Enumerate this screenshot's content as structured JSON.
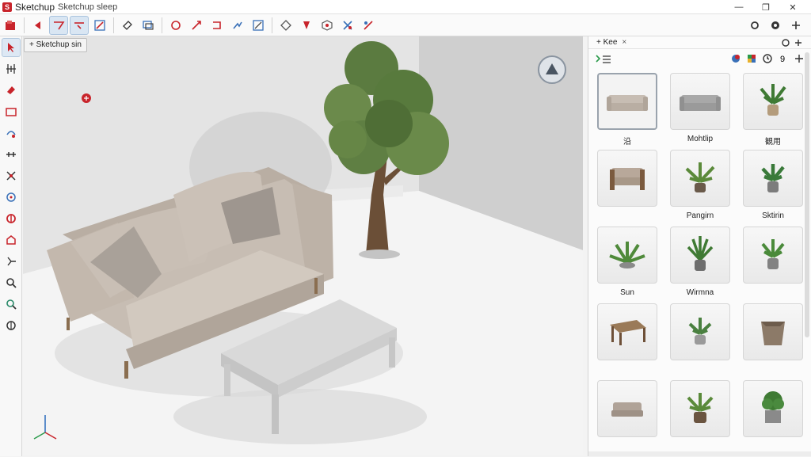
{
  "app": {
    "name": "Sketchup",
    "document": "Sketchup sleep",
    "logo_letter": "S"
  },
  "window": {
    "minimize": "—",
    "maximize": "❐",
    "close": "✕"
  },
  "tooltip": "+ Sketchup sin",
  "panel": {
    "tab_label": "+ Kee",
    "close": "×",
    "items": [
      {
        "label": "沿 ",
        "kind": "sofa-beige"
      },
      {
        "label": "Mohtlip",
        "kind": "sofa-gray"
      },
      {
        "label": "観用 ",
        "kind": "plant-pot"
      },
      {
        "label": "  ",
        "kind": "armchair"
      },
      {
        "label": "Pangirn",
        "kind": "plant-fern"
      },
      {
        "label": "Sktirin",
        "kind": "plant-pot-small"
      },
      {
        "label": " Sun",
        "kind": "plant-agave"
      },
      {
        "label": "Wirmna",
        "kind": "plant-tall"
      },
      {
        "label": "  ",
        "kind": "plant-pot2"
      },
      {
        "label": "  ",
        "kind": "table-wood"
      },
      {
        "label": " ",
        "kind": "plant-small"
      },
      {
        "label": " ",
        "kind": "planter-box"
      },
      {
        "label": "  ",
        "kind": "chair-low"
      },
      {
        "label": "  ",
        "kind": "plant-bush"
      },
      {
        "label": "  ",
        "kind": "plant-cube"
      }
    ]
  },
  "colors": {
    "accent": "#c8242b",
    "sofa": "#c7bdb3",
    "tree": "#5f7f43",
    "table": "#d4d4d4"
  }
}
